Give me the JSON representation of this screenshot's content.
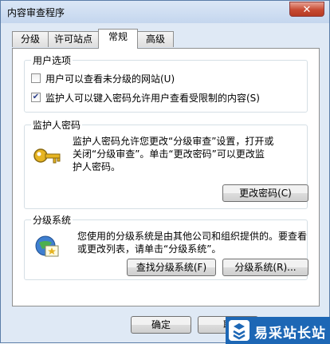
{
  "window": {
    "title": "内容审查程序",
    "close_label": "✕"
  },
  "tabs": [
    {
      "label": "分级"
    },
    {
      "label": "许可站点"
    },
    {
      "label": "常规",
      "active": true
    },
    {
      "label": "高级"
    }
  ],
  "user_options": {
    "label": "用户选项",
    "unrated_checkbox": {
      "label": "用户可以查看未分级的网站(U)",
      "checked": false
    },
    "supervisor_checkbox": {
      "label": "监护人可以键入密码允许用户查看受限制的内容(S)",
      "checked": true
    }
  },
  "supervisor_password": {
    "label": "监护人密码",
    "description_lines": [
      "监护人密码允许您更改“分级审查”设置，打开或",
      "关闭“分级审查”。单击“更改密码”可以更改监",
      "护人密码。"
    ],
    "change_password_button": "更改密码(C)",
    "icon": "key-icon"
  },
  "rating_systems": {
    "label": "分级系统",
    "description_lines": [
      "您使用的分级系统是由其他公司和组织提供的。要查看",
      "或更改列表，请单击“分级系统”。"
    ],
    "find_button": "查找分级系统(F)",
    "systems_button": "分级系统(R)...",
    "icon": "certificate-icon"
  },
  "footer": {
    "ok_button": "确定",
    "cancel_button": "取"
  },
  "watermark": {
    "text": "易采站长站"
  },
  "colors": {
    "window_bg": "#dfe9f5",
    "close_red": "#c74a32",
    "banner_blue": "#1d67b5"
  }
}
